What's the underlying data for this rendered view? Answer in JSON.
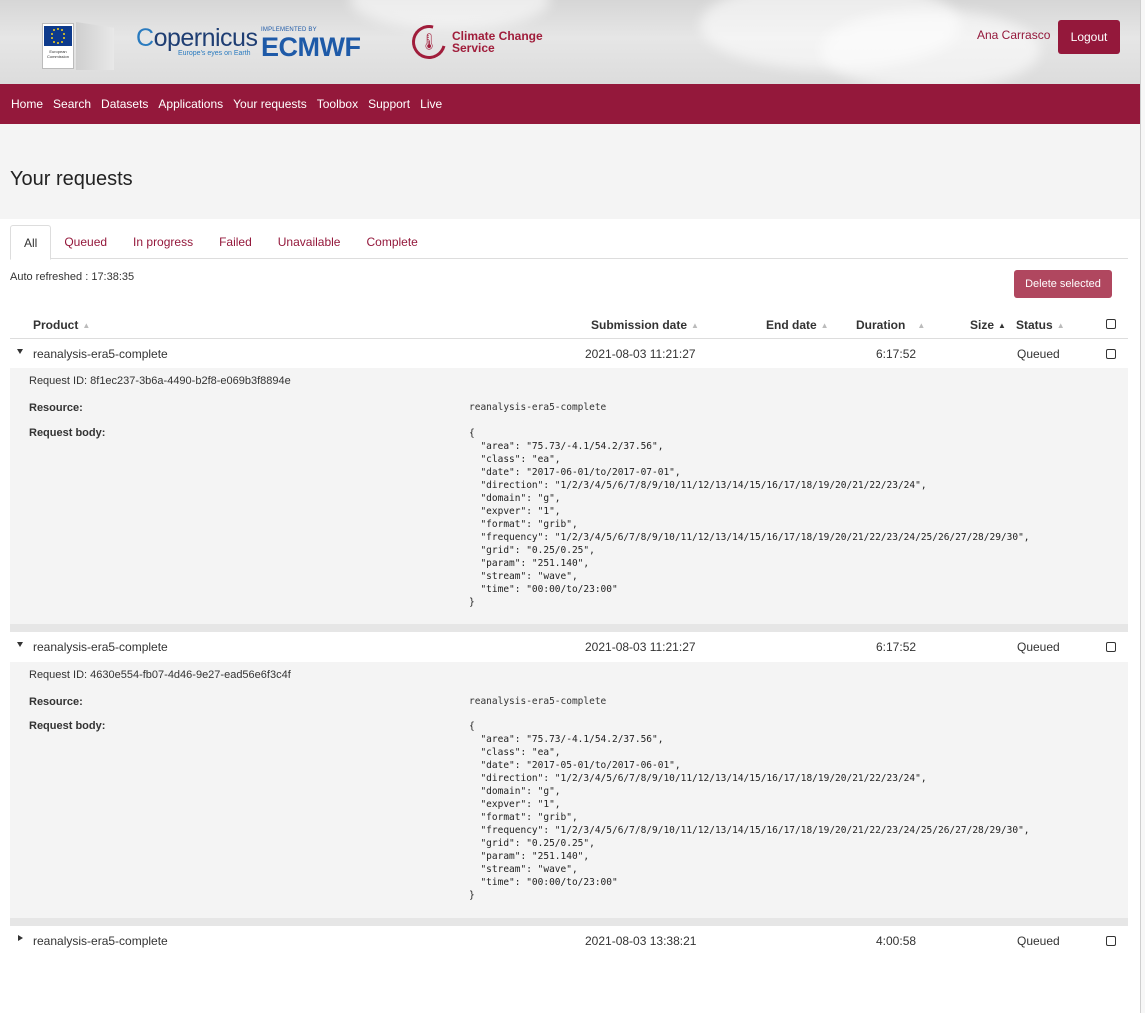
{
  "header": {
    "eu_logo_text": "European Commission",
    "copernicus_prefix": "C",
    "copernicus_word": "opernicus",
    "copernicus_tagline": "Europe's eyes on Earth",
    "ecmwf_implemented": "IMPLEMENTED BY",
    "ecmwf_word": "ECMWF",
    "c3s_line1": "Climate Change",
    "c3s_line2": "Service",
    "user_name": "Ana Carrasco",
    "logout_label": "Logout"
  },
  "nav": {
    "items": [
      "Home",
      "Search",
      "Datasets",
      "Applications",
      "Your requests",
      "Toolbox",
      "Support",
      "Live"
    ]
  },
  "page_title": "Your requests",
  "tabs": [
    "All",
    "Queued",
    "In progress",
    "Failed",
    "Unavailable",
    "Complete"
  ],
  "auto_refresh": "Auto refreshed : 17:38:35",
  "delete_label": "Delete selected",
  "columns": {
    "product": "Product",
    "submission_date": "Submission date",
    "end_date": "End date",
    "duration": "Duration",
    "size": "Size",
    "status": "Status"
  },
  "rows": [
    {
      "product": "reanalysis-era5-complete",
      "submission_date": "2021-08-03 11:21:27",
      "end_date": "",
      "duration": "6:17:52",
      "size": "",
      "status": "Queued",
      "request_id": "Request ID: 8f1ec237-3b6a-4490-b2f8-e069b3f8894e",
      "resource_label": "Resource:",
      "resource": "reanalysis-era5-complete",
      "body_label": "Request body:",
      "body": "{\n  \"area\": \"75.73/-4.1/54.2/37.56\",\n  \"class\": \"ea\",\n  \"date\": \"2017-06-01/to/2017-07-01\",\n  \"direction\": \"1/2/3/4/5/6/7/8/9/10/11/12/13/14/15/16/17/18/19/20/21/22/23/24\",\n  \"domain\": \"g\",\n  \"expver\": \"1\",\n  \"format\": \"grib\",\n  \"frequency\": \"1/2/3/4/5/6/7/8/9/10/11/12/13/14/15/16/17/18/19/20/21/22/23/24/25/26/27/28/29/30\",\n  \"grid\": \"0.25/0.25\",\n  \"param\": \"251.140\",\n  \"stream\": \"wave\",\n  \"time\": \"00:00/to/23:00\"\n}"
    },
    {
      "product": "reanalysis-era5-complete",
      "submission_date": "2021-08-03 11:21:27",
      "end_date": "",
      "duration": "6:17:52",
      "size": "",
      "status": "Queued",
      "request_id": "Request ID: 4630e554-fb07-4d46-9e27-ead56e6f3c4f",
      "resource_label": "Resource:",
      "resource": "reanalysis-era5-complete",
      "body_label": "Request body:",
      "body": "{\n  \"area\": \"75.73/-4.1/54.2/37.56\",\n  \"class\": \"ea\",\n  \"date\": \"2017-05-01/to/2017-06-01\",\n  \"direction\": \"1/2/3/4/5/6/7/8/9/10/11/12/13/14/15/16/17/18/19/20/21/22/23/24\",\n  \"domain\": \"g\",\n  \"expver\": \"1\",\n  \"format\": \"grib\",\n  \"frequency\": \"1/2/3/4/5/6/7/8/9/10/11/12/13/14/15/16/17/18/19/20/21/22/23/24/25/26/27/28/29/30\",\n  \"grid\": \"0.25/0.25\",\n  \"param\": \"251.140\",\n  \"stream\": \"wave\",\n  \"time\": \"00:00/to/23:00\"\n}"
    },
    {
      "product": "reanalysis-era5-complete",
      "submission_date": "2021-08-03 13:38:21",
      "end_date": "",
      "duration": "4:00:58",
      "size": "",
      "status": "Queued"
    }
  ],
  "colors": {
    "brand": "#94183b",
    "delete_button": "#b0475f",
    "detail_bg": "#f4f4f4"
  }
}
